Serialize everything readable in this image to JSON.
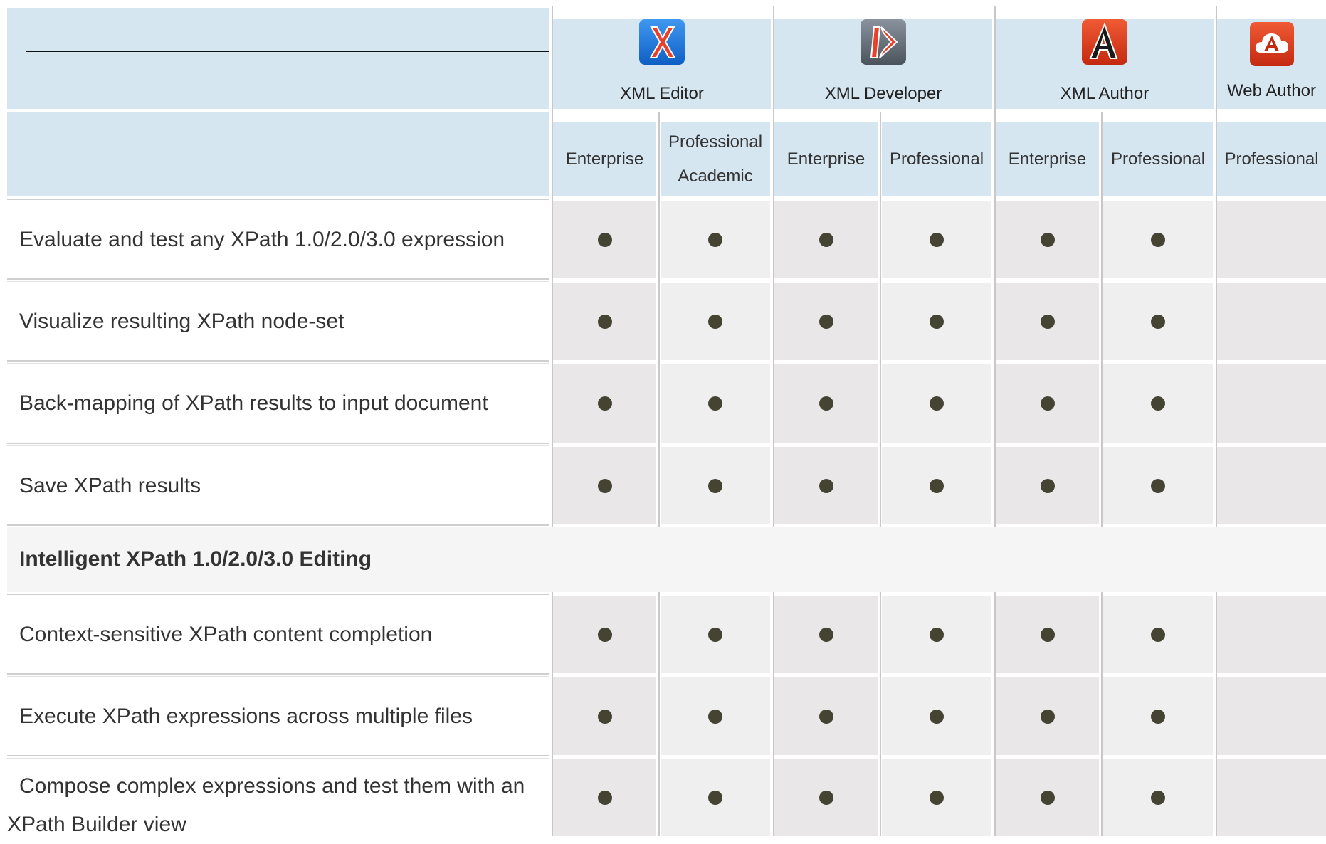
{
  "header": {
    "products": [
      {
        "name": "XML Editor",
        "icon": "oxygen-xml-editor-icon",
        "color": "#1a73d6"
      },
      {
        "name": "XML Developer",
        "icon": "oxygen-xml-developer-icon",
        "color": "#5a6470"
      },
      {
        "name": "XML Author",
        "icon": "oxygen-xml-author-icon",
        "color": "#d33a1d"
      },
      {
        "name": "Web Author",
        "icon": "oxygen-web-author-icon",
        "color": "#d33a1d"
      }
    ],
    "editions": [
      {
        "line1": "Enterprise",
        "line2": ""
      },
      {
        "line1": "Professional",
        "line2": "Academic"
      },
      {
        "line1": "Enterprise",
        "line2": ""
      },
      {
        "line1": "Professional",
        "line2": ""
      },
      {
        "line1": "Enterprise",
        "line2": ""
      },
      {
        "line1": "Professional",
        "line2": ""
      },
      {
        "line1": "Professional",
        "line2": ""
      }
    ]
  },
  "rows": [
    {
      "label": "Evaluate and test any XPath 1.0/2.0/3.0 expression",
      "support": [
        true,
        true,
        true,
        true,
        true,
        true,
        false
      ]
    },
    {
      "label": "Visualize resulting XPath node-set",
      "support": [
        true,
        true,
        true,
        true,
        true,
        true,
        false
      ]
    },
    {
      "label": "Back-mapping of XPath results to input document",
      "support": [
        true,
        true,
        true,
        true,
        true,
        true,
        false
      ]
    },
    {
      "label": "Save XPath results",
      "support": [
        true,
        true,
        true,
        true,
        true,
        true,
        false
      ]
    }
  ],
  "section": {
    "title": "Intelligent XPath 1.0/2.0/3.0 Editing"
  },
  "rows2": [
    {
      "label": "Context-sensitive XPath content completion",
      "support": [
        true,
        true,
        true,
        true,
        true,
        true,
        false
      ]
    },
    {
      "label": "Execute XPath expressions across multiple files",
      "support": [
        true,
        true,
        true,
        true,
        true,
        true,
        false
      ]
    },
    {
      "label_line1": "Compose complex expressions and test them with an",
      "label_line2": "XPath Builder view",
      "support": [
        true,
        true,
        true,
        true,
        true,
        true,
        false
      ]
    }
  ]
}
